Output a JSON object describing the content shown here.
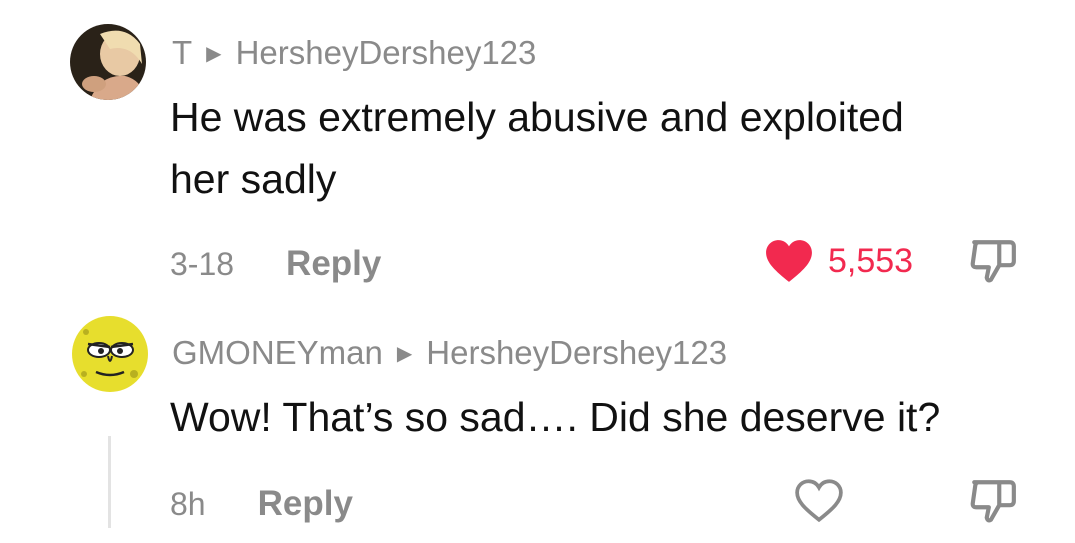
{
  "comments": [
    {
      "author": "T",
      "reply_to": "HersheyDershey123",
      "text_line1": "He was extremely abusive and exploited",
      "text_line2": "her sadly",
      "date": "3-18",
      "reply_label": "Reply",
      "likes": "5,553",
      "liked": true,
      "avatar_icon": "user-photo-avatar",
      "like_icon": "heart-filled-icon",
      "dislike_icon": "thumbs-down-icon"
    },
    {
      "author": "GMONEYman",
      "reply_to": "HersheyDershey123",
      "text": "Wow! That’s so sad…. Did she deserve it?",
      "date": "8h",
      "reply_label": "Reply",
      "liked": false,
      "avatar_icon": "cartoon-sponge-avatar",
      "like_icon": "heart-outline-icon",
      "dislike_icon": "thumbs-down-icon"
    }
  ],
  "colors": {
    "like_active": "#f2294f",
    "muted": "#8a8a8a",
    "text": "#111111"
  }
}
